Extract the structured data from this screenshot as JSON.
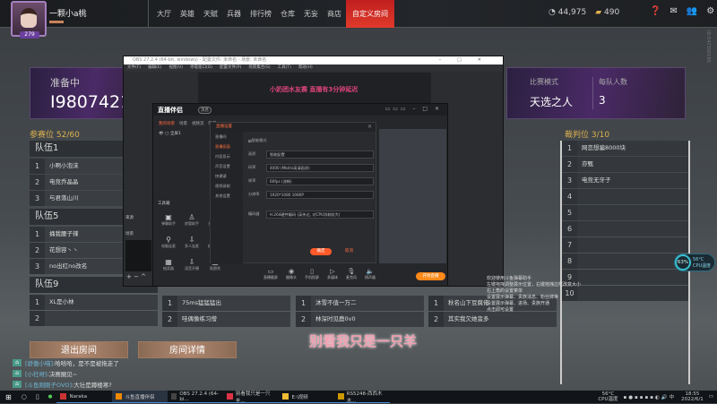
{
  "user": {
    "name": "一颗小a桃",
    "level": "279"
  },
  "nav": [
    "大厅",
    "英雄",
    "天赋",
    "兵器",
    "排行榜",
    "仓库",
    "无妄",
    "商店",
    "自定义房间"
  ],
  "nav_active": "自定义房间",
  "currency": {
    "coins": "44,975",
    "gold": "490"
  },
  "side_id": "ID:547300180",
  "room": {
    "status": "准备中",
    "room_id": "I9807421",
    "mode_label": "比赛模式",
    "mode_value": "天选之人",
    "team_size_label": "每队人数",
    "team_size_value": "3"
  },
  "participants": {
    "label": "参赛位 52/60"
  },
  "teams": [
    {
      "name": "队伍1",
      "players": [
        "小啊小泡沫",
        "电竞乔晶晶",
        "与君落山川"
      ]
    },
    {
      "name": "队伍5",
      "players": [
        "捅我腰子辣",
        "花想容丶丶",
        "no出红no改名"
      ]
    },
    {
      "name": "队伍9",
      "players": [
        "XL是小林",
        "",
        ""
      ]
    }
  ],
  "more_teams": [
    {
      "players": [
        "75ms猛猛猛出",
        "哇偶像练习僧"
      ]
    },
    {
      "players": [
        "沐雪不值一万二",
        "林深时见鹿0v0"
      ]
    },
    {
      "players": [
        "秋名山下豆腐佬",
        "其实我欠她蛮多"
      ]
    }
  ],
  "judges": {
    "label": "裁判位 3/10",
    "list": [
      "网恋想骗8000块",
      "亦甄",
      "电竞无牙子",
      "",
      "",
      "",
      "",
      "",
      "",
      ""
    ]
  },
  "buttons": {
    "exit": "退出房间",
    "details": "房间详情"
  },
  "chat": [
    {
      "name": "[骄傲小喵]",
      "msg": ":哈哈哈，是不是被拖走了"
    },
    {
      "name": "[小社呀]",
      "msg": ":决赛圈见~"
    },
    {
      "name": "[斗鱼刚刚子OVO]",
      "msg": ":大壮是蹲楼寒?"
    }
  ],
  "subtitle": "别看我只是一只羊",
  "obs": {
    "title": "OBS 27.2.4 (64-bit, windows) - 配置文件: 未命名 - 场景: 未命名",
    "menu": [
      "文件(F)",
      "编辑(E)",
      "视图(V)",
      "停靠窗口(D)",
      "配置文件(P)",
      "场景集合(S)",
      "工具(T)",
      "帮助(H)"
    ],
    "banner": "小奶团水友赛 直播有3分钟延迟",
    "scenes_label": "来源",
    "sources_label": "场景"
  },
  "streamer_app": {
    "logo": "直播伴侣",
    "badge": "消息",
    "tabs": [
      "我的场景",
      "场景",
      "视频流",
      "隐藏"
    ],
    "scene_item": "全屏1",
    "tools_label": "工具箱",
    "tools": [
      "弹幕助手",
      "房管助手",
      "主播任务",
      "电脑连麦",
      "多人连麦",
      "横屏助手",
      "抽奖器",
      "语音开播",
      "贴图秀"
    ],
    "dialog": {
      "title": "直播设置",
      "menu": [
        "直播间",
        "直播画面",
        "内容显示",
        "声音设置",
        "快捷键",
        "视频录制",
        "其他设置"
      ],
      "active": "直播画面",
      "smart_mode": "智能模式",
      "fields": [
        {
          "label": "画质",
          "value": "智能配置"
        },
        {
          "label": "码率",
          "value": "4000 (Mbit/s高清画质)"
        },
        {
          "label": "帧率",
          "value": "60fps (流畅)"
        },
        {
          "label": "分辨率",
          "value": "1920*1080 1080P"
        },
        {
          "label": "编码器",
          "value": "H.264硬件编码 (英伟达, 对CPU消耗较大)"
        }
      ],
      "ok": "确定",
      "cancel": "取消"
    },
    "bottom": [
      "直播截屏",
      "摄像头",
      "手机投屏",
      "多媒体",
      "麦克风",
      "扬声器"
    ],
    "live_button": "开始直播"
  },
  "cpu": {
    "percent": "63%",
    "temp": "56°C",
    "label": "CPU温度"
  },
  "overlay_notes": [
    "欢迎使用斗鱼弹幕助手",
    "左键拖拽调整展示位置，右键拖拽边框改变大小",
    "右上角的设置菜单",
    "设置展示弹幕、贵族消息、粉丝牌等",
    "设置展示弹幕、进场、贵族开通",
    "点击即可设置"
  ],
  "taskbar": {
    "apps": [
      "Naraka",
      "斗鱼直播伴侣",
      "OBS 27.2.4 (64-bi...",
      "别看我只是一只羊...",
      "E:\\视频",
      "RS5248-西西木木..."
    ],
    "temp": "56°C",
    "temp_label": "CPU温度",
    "time": "18:55",
    "date": "2022/6/1"
  }
}
